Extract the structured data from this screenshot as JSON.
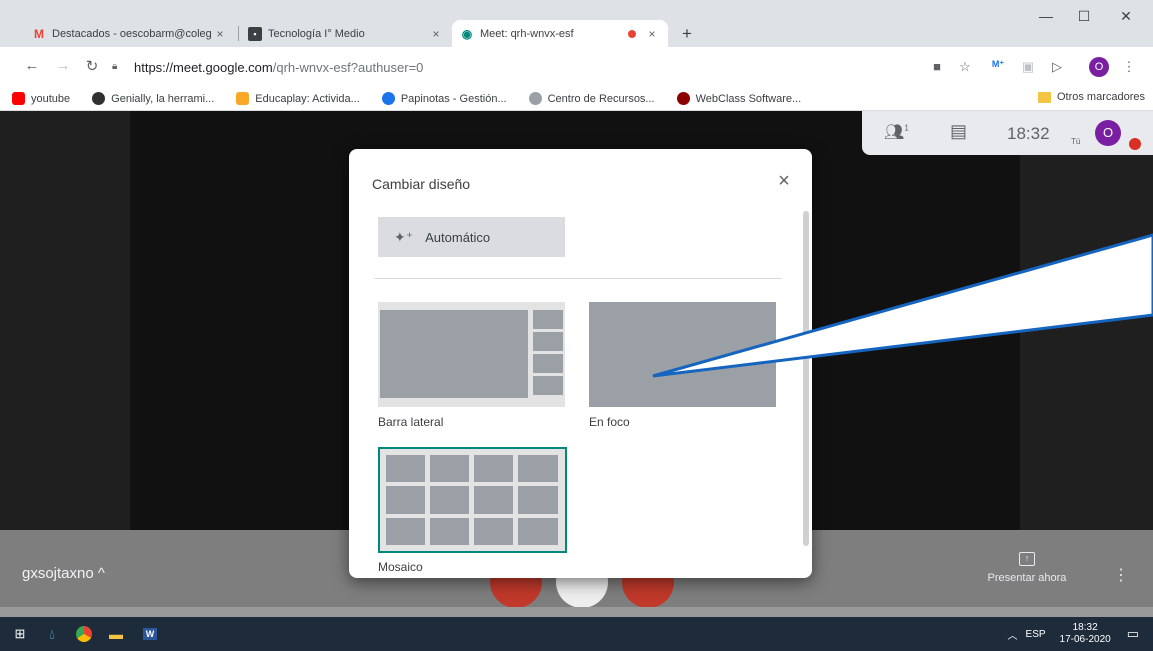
{
  "browser": {
    "tabs": [
      {
        "title": "Destacados - oescobarm@colegi",
        "icon": "gmail-icon"
      },
      {
        "title": "Tecnología I° Medio",
        "icon": "classroom-icon"
      },
      {
        "title": "Meet: qrh-wnvx-esf",
        "icon": "meet-icon",
        "active": true
      }
    ],
    "new_tab": "+",
    "tab_close": "×",
    "url_host": "https://meet.google.com",
    "url_path": "/qrh-wnvx-esf?authuser=0",
    "profile_initial": "O",
    "bookmarks": [
      {
        "label": "youtube",
        "color": "#ff0000"
      },
      {
        "label": "Genially, la herrami...",
        "color": "#303030"
      },
      {
        "label": "Educaplay: Activida...",
        "color": "#f9a825"
      },
      {
        "label": "Papinotas - Gestión...",
        "color": "#1a73e8"
      },
      {
        "label": "Centro de Recursos...",
        "color": "#9aa0a6"
      },
      {
        "label": "WebClass Software...",
        "color": "#8b0000"
      }
    ],
    "other_bookmarks": "Otros marcadores"
  },
  "meet": {
    "participants_count": "1",
    "time": "18:32",
    "you_label": "Tú",
    "avatar_initial": "O",
    "meeting_code": "gxsojtaxno ^",
    "present_label": "Presentar ahora"
  },
  "dialog": {
    "title": "Cambiar diseño",
    "close": "×",
    "auto_label": "Automático",
    "layouts": [
      {
        "label": "Barra lateral"
      },
      {
        "label": "En foco"
      },
      {
        "label": "Mosaico"
      }
    ]
  },
  "taskbar": {
    "lang": "ESP",
    "clock_time": "18:32",
    "clock_date": "17-06-2020"
  },
  "colors": {
    "accent_blue": "#1a73e8",
    "meet_green": "#00897b",
    "callout_blue": "#1565c0"
  }
}
